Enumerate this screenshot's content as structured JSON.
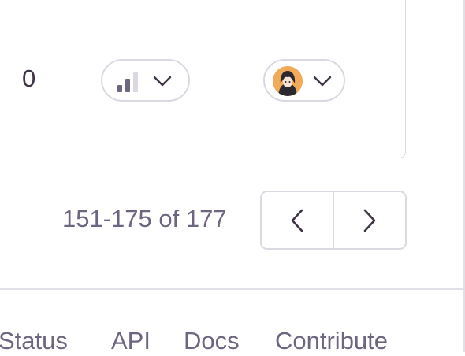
{
  "row": {
    "count": "0",
    "priority": {
      "icon": "priority-bars-icon",
      "level_of_3": 2
    },
    "assignee": {
      "icon": "avatar"
    }
  },
  "pagination": {
    "range_text": "151-175 of 177",
    "prev_icon": "chevron-left-icon",
    "next_icon": "chevron-right-icon"
  },
  "footer": {
    "links": [
      "Status",
      "API",
      "Docs",
      "Contribute"
    ]
  },
  "colors": {
    "text": "#3e3446",
    "muted": "#6e6680",
    "border": "#dcd8e2",
    "bar_active": "#6e6680",
    "bar_inactive": "#dcd8e2",
    "avatar_bg": "#f1a95a"
  }
}
